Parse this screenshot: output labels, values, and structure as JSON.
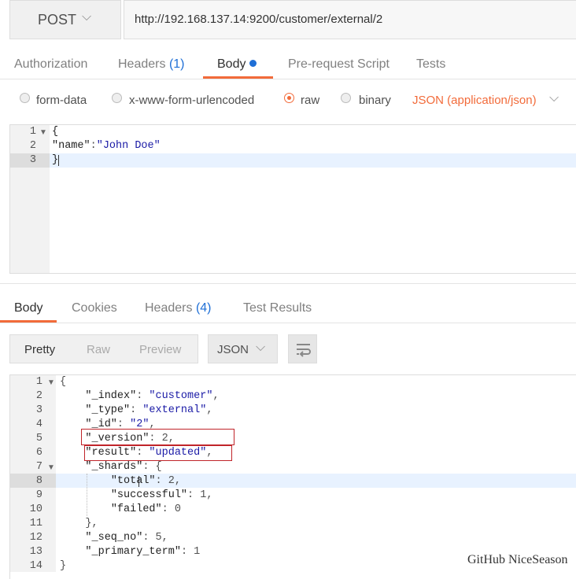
{
  "request": {
    "method": "POST",
    "url": "http://192.168.137.14:9200/customer/external/2"
  },
  "request_tabs": [
    {
      "label": "Authorization",
      "count": ""
    },
    {
      "label": "Headers",
      "count": "(1)"
    },
    {
      "label": "Body",
      "count": ""
    },
    {
      "label": "Pre-request Script",
      "count": ""
    },
    {
      "label": "Tests",
      "count": ""
    }
  ],
  "body_options": {
    "form_data": "form-data",
    "urlencoded": "x-www-form-urlencoded",
    "raw": "raw",
    "binary": "binary",
    "selected": "raw",
    "content_type": "JSON (application/json)"
  },
  "request_body": {
    "line_numbers": [
      "1",
      "2",
      "3"
    ],
    "lines": [
      "{",
      "  \"name\":\"John Doe\"",
      "}"
    ],
    "key": "\"name\"",
    "value": "\"John Doe\""
  },
  "response_tabs": [
    {
      "label": "Body",
      "count": ""
    },
    {
      "label": "Cookies",
      "count": ""
    },
    {
      "label": "Headers",
      "count": "(4)"
    },
    {
      "label": "Test Results",
      "count": ""
    }
  ],
  "response_view": {
    "modes": [
      "Pretty",
      "Raw",
      "Preview"
    ],
    "selected_mode": "Pretty",
    "format": "JSON"
  },
  "response_body": {
    "line_numbers": [
      "1",
      "2",
      "3",
      "4",
      "5",
      "6",
      "7",
      "8",
      "9",
      "10",
      "11",
      "12",
      "13",
      "14"
    ],
    "lines": [
      "{",
      "    \"_index\": \"customer\",",
      "    \"_type\": \"external\",",
      "    \"_id\": \"2\",",
      "    \"_version\": 2,",
      "    \"result\": \"updated\",",
      "    \"_shards\": {",
      "        \"total\": 2,",
      "        \"successful\": 1,",
      "        \"failed\": 0",
      "    },",
      "    \"_seq_no\": 5,",
      "    \"_primary_term\": 1",
      "}"
    ]
  },
  "watermark": "GitHub NiceSeason",
  "colors": {
    "accent": "#f26b3a",
    "link": "#1f6fd6",
    "highlight_box": "#c0242a"
  }
}
